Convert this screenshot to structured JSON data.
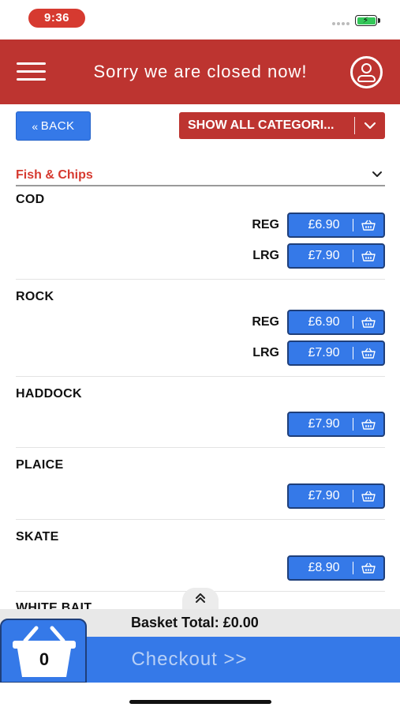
{
  "status_bar": {
    "time": "9:36"
  },
  "header": {
    "title": "Sorry we are closed now!"
  },
  "nav": {
    "back_label": "BACK",
    "category_select": "SHOW ALL CATEGORI..."
  },
  "section": {
    "title": "Fish & Chips"
  },
  "items": [
    {
      "name": "COD",
      "options": [
        {
          "size": "REG",
          "price": "£6.90"
        },
        {
          "size": "LRG",
          "price": "£7.90"
        }
      ]
    },
    {
      "name": "ROCK",
      "options": [
        {
          "size": "REG",
          "price": "£6.90"
        },
        {
          "size": "LRG",
          "price": "£7.90"
        }
      ]
    },
    {
      "name": "HADDOCK",
      "options": [
        {
          "size": "",
          "price": "£7.90"
        }
      ]
    },
    {
      "name": "PLAICE",
      "options": [
        {
          "size": "",
          "price": "£7.90"
        }
      ]
    },
    {
      "name": "SKATE",
      "options": [
        {
          "size": "",
          "price": "£8.90"
        }
      ]
    },
    {
      "name": "WHITE BAIT"
    }
  ],
  "basket": {
    "total": "Basket Total: £0.00",
    "count": "0",
    "checkout_label": "Checkout >>"
  },
  "colors": {
    "header_red": "#bd3430",
    "accent_blue": "#3579e8",
    "section_red": "#d63a30"
  },
  "icons": [
    "hamburger-menu-icon",
    "profile-icon",
    "double-chevron-left-icon",
    "chevron-down-icon",
    "basket-icon",
    "double-chevron-up-icon"
  ]
}
